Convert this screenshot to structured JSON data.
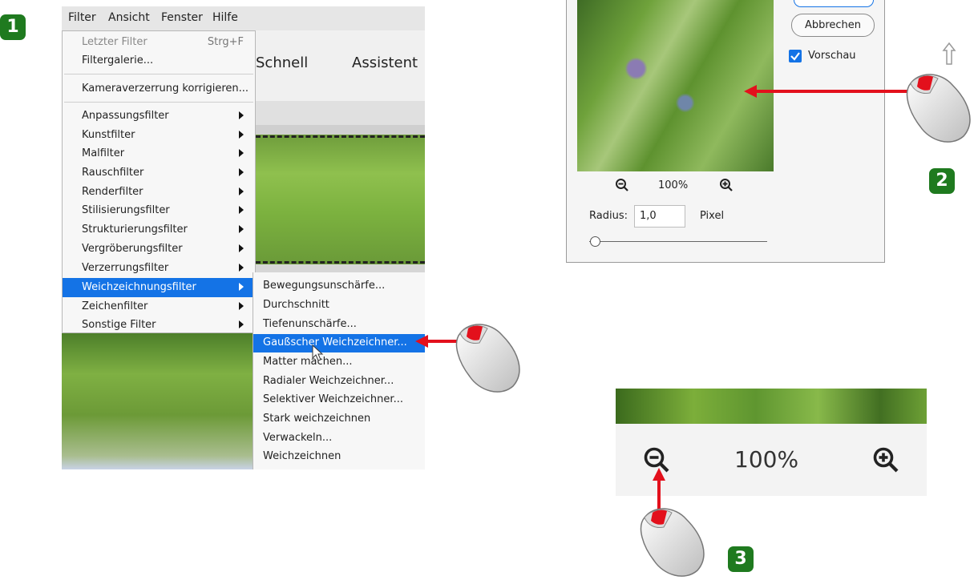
{
  "badges": {
    "step1": "1",
    "step2": "2",
    "step3": "3"
  },
  "panel1": {
    "menubar": [
      "Filter",
      "Ansicht",
      "Fenster",
      "Hilfe"
    ],
    "app_modes": [
      "Schnell",
      "Assistent"
    ],
    "menu": {
      "last_filter": {
        "label": "Letzter Filter",
        "shortcut": "Strg+F"
      },
      "filter_gallery": "Filtergalerie...",
      "camera_distortion": "Kameraverzerrung korrigieren...",
      "submenus": [
        "Anpassungsfilter",
        "Kunstfilter",
        "Malfilter",
        "Rauschfilter",
        "Renderfilter",
        "Stilisierungsfilter",
        "Strukturierungsfilter",
        "Vergröberungsfilter",
        "Verzerrungsfilter",
        "Weichzeichnungsfilter",
        "Zeichenfilter",
        "Sonstige Filter"
      ]
    },
    "blur_submenu": [
      "Bewegungsunschärfe...",
      "Durchschnitt",
      "Tiefenunschärfe...",
      "Gaußscher Weichzeichner...",
      "Matter machen...",
      "Radialer Weichzeichner...",
      "Selektiver Weichzeichner...",
      "Stark weichzeichnen",
      "Verwackeln...",
      "Weichzeichnen"
    ]
  },
  "panel2": {
    "cancel_button": "Abbrechen",
    "preview_checkbox": "Vorschau",
    "zoom_value": "100%",
    "radius_label": "Radius:",
    "radius_value": "1,0",
    "radius_unit": "Pixel",
    "radius_slider_fraction": 0.03
  },
  "panel3": {
    "zoom_value": "100%"
  },
  "colors": {
    "highlight": "#1473e6",
    "badge": "#1f7a1f",
    "arrow": "#e3101c"
  }
}
